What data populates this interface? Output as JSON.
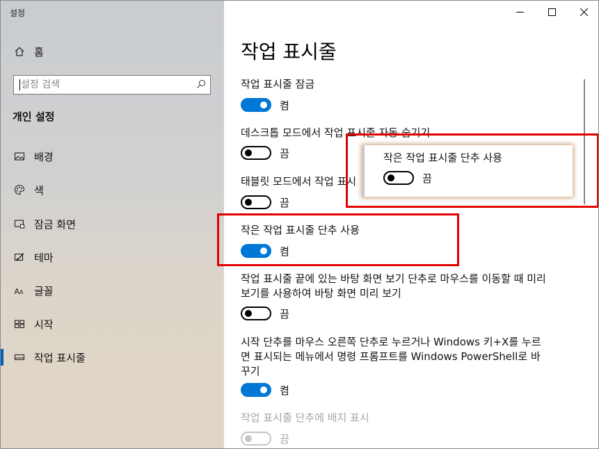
{
  "window": {
    "app_title": "설정",
    "controls": [
      "minimize-icon",
      "maximize-icon",
      "close-icon"
    ]
  },
  "sidebar": {
    "home_label": "홈",
    "search_placeholder": "설정 검색",
    "section_title": "개인 설정",
    "items": [
      {
        "label": "배경",
        "icon": "image-icon"
      },
      {
        "label": "색",
        "icon": "palette-icon"
      },
      {
        "label": "잠금 화면",
        "icon": "lock-screen-icon"
      },
      {
        "label": "테마",
        "icon": "theme-icon"
      },
      {
        "label": "글꼴",
        "icon": "font-icon"
      },
      {
        "label": "시작",
        "icon": "start-icon"
      },
      {
        "label": "작업 표시줄",
        "icon": "taskbar-icon",
        "active": true
      }
    ],
    "accent_color": "#0063b1"
  },
  "main": {
    "page_title": "작업 표시줄",
    "settings": [
      {
        "label": "작업 표시줄 잠금",
        "state": "켬"
      },
      {
        "label": "데스크톱 모드에서 작업 표시줄 자동 숨기기",
        "state": "끔"
      },
      {
        "label": "태블릿 모드에서 작업 표시",
        "state": "끔"
      },
      {
        "label": "작은 작업 표시줄 단추 사용",
        "state": "켬"
      },
      {
        "label": "작업 표시줄 끝에 있는 바탕 화면 보기 단추로 마우스를 이동할 때 미리 보기를 사용하여 바탕 화면 미리 보기",
        "state": "끔"
      },
      {
        "label": "시작 단추를 마우스 오른쪽 단추로 누르거나 Windows 키+X를 누르면 표시되는 메뉴에서 명령 프롬프트를 Windows PowerShell로 바꾸기",
        "state": "켬"
      },
      {
        "label": "작업 표시줄 단추에 배지 표시",
        "state": "끔",
        "disabled": true
      }
    ],
    "toggle_on_color": "#0078d7"
  },
  "popup": {
    "label": "작은 작업 표시줄 단추 사용",
    "state": "끔"
  },
  "highlight_color": "#e00000"
}
